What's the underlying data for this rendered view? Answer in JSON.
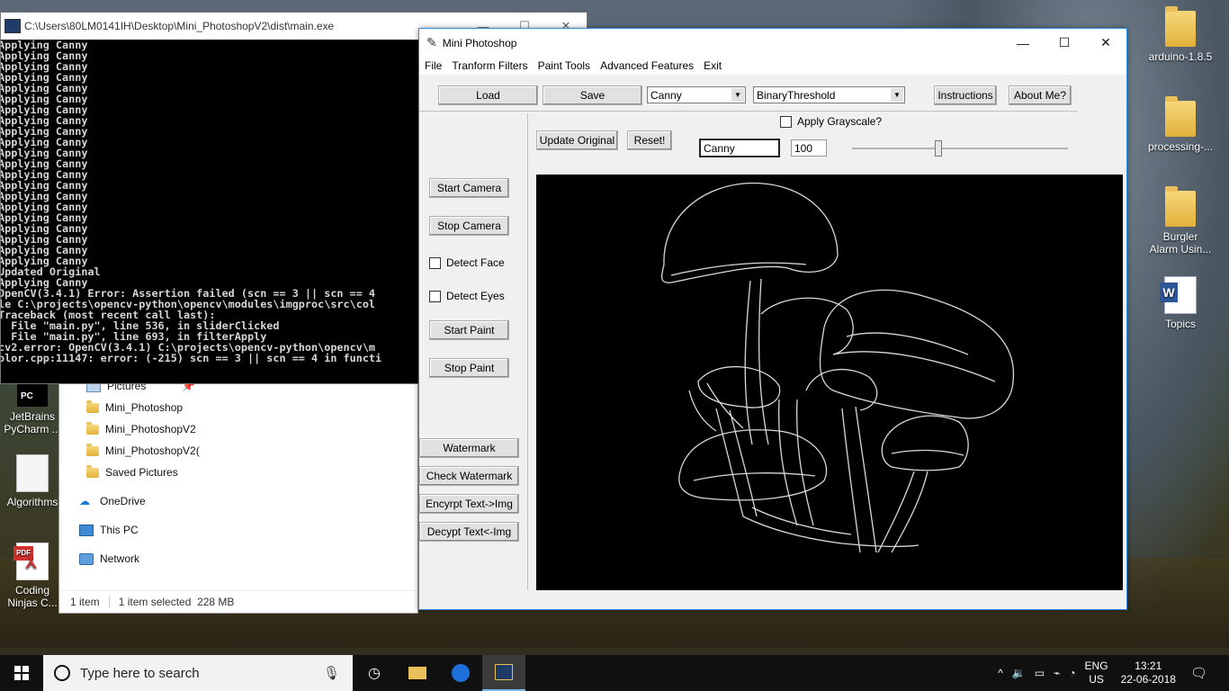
{
  "desktop": {
    "icons_left": [
      {
        "label": "JetBrains PyCharm ...",
        "type": "pycharm"
      },
      {
        "label": "Algorithms",
        "type": "doc"
      },
      {
        "label": "Coding Ninjas C...",
        "type": "pdf",
        "badge": "PDF"
      }
    ],
    "icons_right": [
      {
        "label": "arduino-1.8.5",
        "type": "folder"
      },
      {
        "label": "processing-...",
        "type": "folder"
      },
      {
        "label": "Burgler Alarm Usin...",
        "type": "folder"
      },
      {
        "label": "Topics",
        "type": "word"
      }
    ]
  },
  "console": {
    "title": "C:\\Users\\80LM0141IH\\Desktop\\Mini_PhotoshopV2\\dist\\main.exe",
    "lines": [
      "Applying Canny",
      "Applying Canny",
      "Applying Canny",
      "Applying Canny",
      "Applying Canny",
      "Applying Canny",
      "Applying Canny",
      "Applying Canny",
      "Applying Canny",
      "Applying Canny",
      "Applying Canny",
      "Applying Canny",
      "Applying Canny",
      "Applying Canny",
      "Applying Canny",
      "Applying Canny",
      "Applying Canny",
      "Applying Canny",
      "Applying Canny",
      "Applying Canny",
      "Applying Canny",
      "Updated Original",
      "Applying Canny",
      "OpenCV(3.4.1) Error: Assertion failed (scn == 3 || scn == 4",
      "le C:\\projects\\opencv-python\\opencv\\modules\\imgproc\\src\\col",
      "Traceback (most recent call last):",
      "  File \"main.py\", line 536, in sliderClicked",
      "  File \"main.py\", line 693, in filterApply",
      "cv2.error: OpenCV(3.4.1) C:\\projects\\opencv-python\\opencv\\m",
      "olor.cpp:11147: error: (-215) scn == 3 || scn == 4 in functi"
    ]
  },
  "explorer": {
    "nav": [
      {
        "label": "Pictures",
        "icon": "pictures-icon"
      },
      {
        "label": "Mini_Photoshop",
        "icon": "folder-icon"
      },
      {
        "label": "Mini_PhotoshopV2",
        "icon": "folder-icon"
      },
      {
        "label": "Mini_PhotoshopV2(",
        "icon": "folder-icon"
      },
      {
        "label": "Saved Pictures",
        "icon": "folder-icon"
      },
      {
        "label": "OneDrive",
        "icon": "cloud-icon"
      },
      {
        "label": "This PC",
        "icon": "pc-icon"
      },
      {
        "label": "Network",
        "icon": "network-icon"
      }
    ],
    "status": {
      "items": "1 item",
      "selected": "1 item selected  228 MB"
    }
  },
  "app": {
    "title": "Mini Photoshop",
    "menu": [
      "File",
      "Tranform Filters",
      "Paint Tools",
      "Advanced Features",
      "Exit"
    ],
    "toolbar": {
      "load": "Load",
      "save": "Save",
      "filter_select": "Canny",
      "threshold_select": "BinaryThreshold",
      "instructions": "Instructions",
      "about": "About Me?"
    },
    "grayscale_label": "Apply Grayscale?",
    "update_original": "Update Original",
    "reset": "Reset!",
    "filter_name_value": "Canny",
    "slider_value": "100",
    "slider_fraction": 0.4,
    "side_buttons": {
      "start_camera": "Start Camera",
      "stop_camera": "Stop Camera",
      "detect_face": "Detect Face",
      "detect_eyes": "Detect Eyes",
      "start_paint": "Start Paint",
      "stop_paint": "Stop Paint",
      "watermark": "Watermark",
      "check_watermark": "Check Watermark",
      "encrypt": "Encyrpt Text->Img",
      "decrypt": "Decypt Text<-Img"
    }
  },
  "taskbar": {
    "search_placeholder": "Type here to search",
    "lang_top": "ENG",
    "lang_bottom": "US",
    "time": "13:21",
    "date": "22-06-2018"
  },
  "colors": {
    "accent": "#2f8ee0",
    "console_bg": "#000000",
    "taskbar_bg": "#101010"
  }
}
